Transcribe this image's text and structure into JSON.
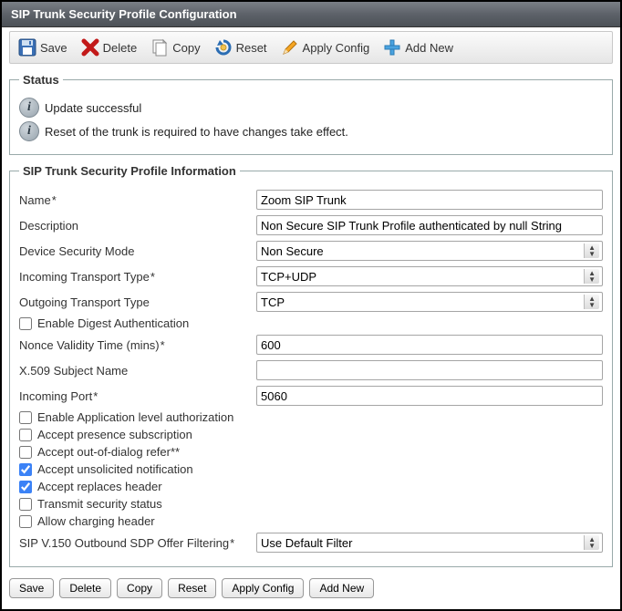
{
  "titleBar": "SIP Trunk Security Profile Configuration",
  "toolbar": {
    "save": "Save",
    "delete": "Delete",
    "copy": "Copy",
    "reset": "Reset",
    "applyConfig": "Apply Config",
    "addNew": "Add New"
  },
  "status": {
    "legend": "Status",
    "update": "Update successful",
    "resetNote": "Reset of the trunk is required to have changes take effect."
  },
  "info": {
    "legend": "SIP Trunk Security Profile Information",
    "labels": {
      "name": "Name",
      "description": "Description",
      "deviceSecurityMode": "Device Security Mode",
      "incomingTransport": "Incoming Transport Type",
      "outgoingTransport": "Outgoing Transport Type",
      "enableDigest": "Enable Digest Authentication",
      "nonceValidity": "Nonce Validity Time (mins)",
      "x509": "X.509 Subject Name",
      "incomingPort": "Incoming Port",
      "enableAppAuth": "Enable Application level authorization",
      "acceptPresence": "Accept presence subscription",
      "acceptOutOfDialog": "Accept out-of-dialog refer",
      "acceptUnsolicited": "Accept unsolicited notification",
      "acceptReplaces": "Accept replaces header",
      "transmitSecurity": "Transmit security status",
      "allowCharging": "Allow charging header",
      "sdpFiltering": "SIP V.150 Outbound SDP Offer Filtering"
    },
    "values": {
      "name": "Zoom SIP Trunk",
      "description": "Non Secure SIP Trunk Profile authenticated by null String",
      "deviceSecurityMode": "Non Secure",
      "incomingTransport": "TCP+UDP",
      "outgoingTransport": "TCP",
      "nonceValidity": "600",
      "x509": "",
      "incomingPort": "5060",
      "sdpFiltering": "Use Default Filter"
    }
  },
  "bottomButtons": {
    "save": "Save",
    "delete": "Delete",
    "copy": "Copy",
    "reset": "Reset",
    "applyConfig": "Apply Config",
    "addNew": "Add New"
  }
}
